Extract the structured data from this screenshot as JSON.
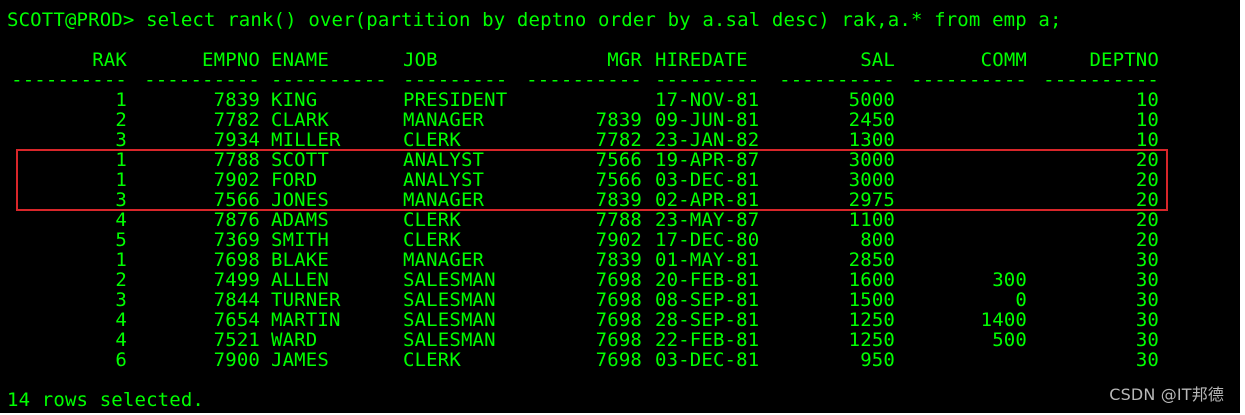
{
  "terminal": {
    "prompt": "SCOTT@PROD> ",
    "command": "select rank() over(partition by deptno order by a.sal desc) rak,a.* from emp a;",
    "footer": "14 rows selected.",
    "watermark": "CSDN @IT邦德",
    "highlight_color": "#d8262a",
    "text_color": "#00ff00",
    "background_color": "#000000"
  },
  "table": {
    "headers": [
      "RAK",
      "EMPNO",
      "ENAME",
      "JOB",
      "MGR",
      "HIREDATE",
      "SAL",
      "COMM",
      "DEPTNO"
    ],
    "separators": [
      "----------",
      "----------",
      "----------",
      "---------",
      "----------",
      "---------",
      "----------",
      "----------",
      "----------"
    ],
    "rows": [
      [
        "1",
        "7839",
        "KING",
        "PRESIDENT",
        "",
        "17-NOV-81",
        "5000",
        "",
        "10"
      ],
      [
        "2",
        "7782",
        "CLARK",
        "MANAGER",
        "7839",
        "09-JUN-81",
        "2450",
        "",
        "10"
      ],
      [
        "3",
        "7934",
        "MILLER",
        "CLERK",
        "7782",
        "23-JAN-82",
        "1300",
        "",
        "10"
      ],
      [
        "1",
        "7788",
        "SCOTT",
        "ANALYST",
        "7566",
        "19-APR-87",
        "3000",
        "",
        "20"
      ],
      [
        "1",
        "7902",
        "FORD",
        "ANALYST",
        "7566",
        "03-DEC-81",
        "3000",
        "",
        "20"
      ],
      [
        "3",
        "7566",
        "JONES",
        "MANAGER",
        "7839",
        "02-APR-81",
        "2975",
        "",
        "20"
      ],
      [
        "4",
        "7876",
        "ADAMS",
        "CLERK",
        "7788",
        "23-MAY-87",
        "1100",
        "",
        "20"
      ],
      [
        "5",
        "7369",
        "SMITH",
        "CLERK",
        "7902",
        "17-DEC-80",
        "800",
        "",
        "20"
      ],
      [
        "1",
        "7698",
        "BLAKE",
        "MANAGER",
        "7839",
        "01-MAY-81",
        "2850",
        "",
        "30"
      ],
      [
        "2",
        "7499",
        "ALLEN",
        "SALESMAN",
        "7698",
        "20-FEB-81",
        "1600",
        "300",
        "30"
      ],
      [
        "3",
        "7844",
        "TURNER",
        "SALESMAN",
        "7698",
        "08-SEP-81",
        "1500",
        "0",
        "30"
      ],
      [
        "4",
        "7654",
        "MARTIN",
        "SALESMAN",
        "7698",
        "28-SEP-81",
        "1250",
        "1400",
        "30"
      ],
      [
        "4",
        "7521",
        "WARD",
        "SALESMAN",
        "7698",
        "22-FEB-81",
        "1250",
        "500",
        "30"
      ],
      [
        "6",
        "7900",
        "JAMES",
        "CLERK",
        "7698",
        "03-DEC-81",
        "950",
        "",
        "30"
      ]
    ]
  }
}
